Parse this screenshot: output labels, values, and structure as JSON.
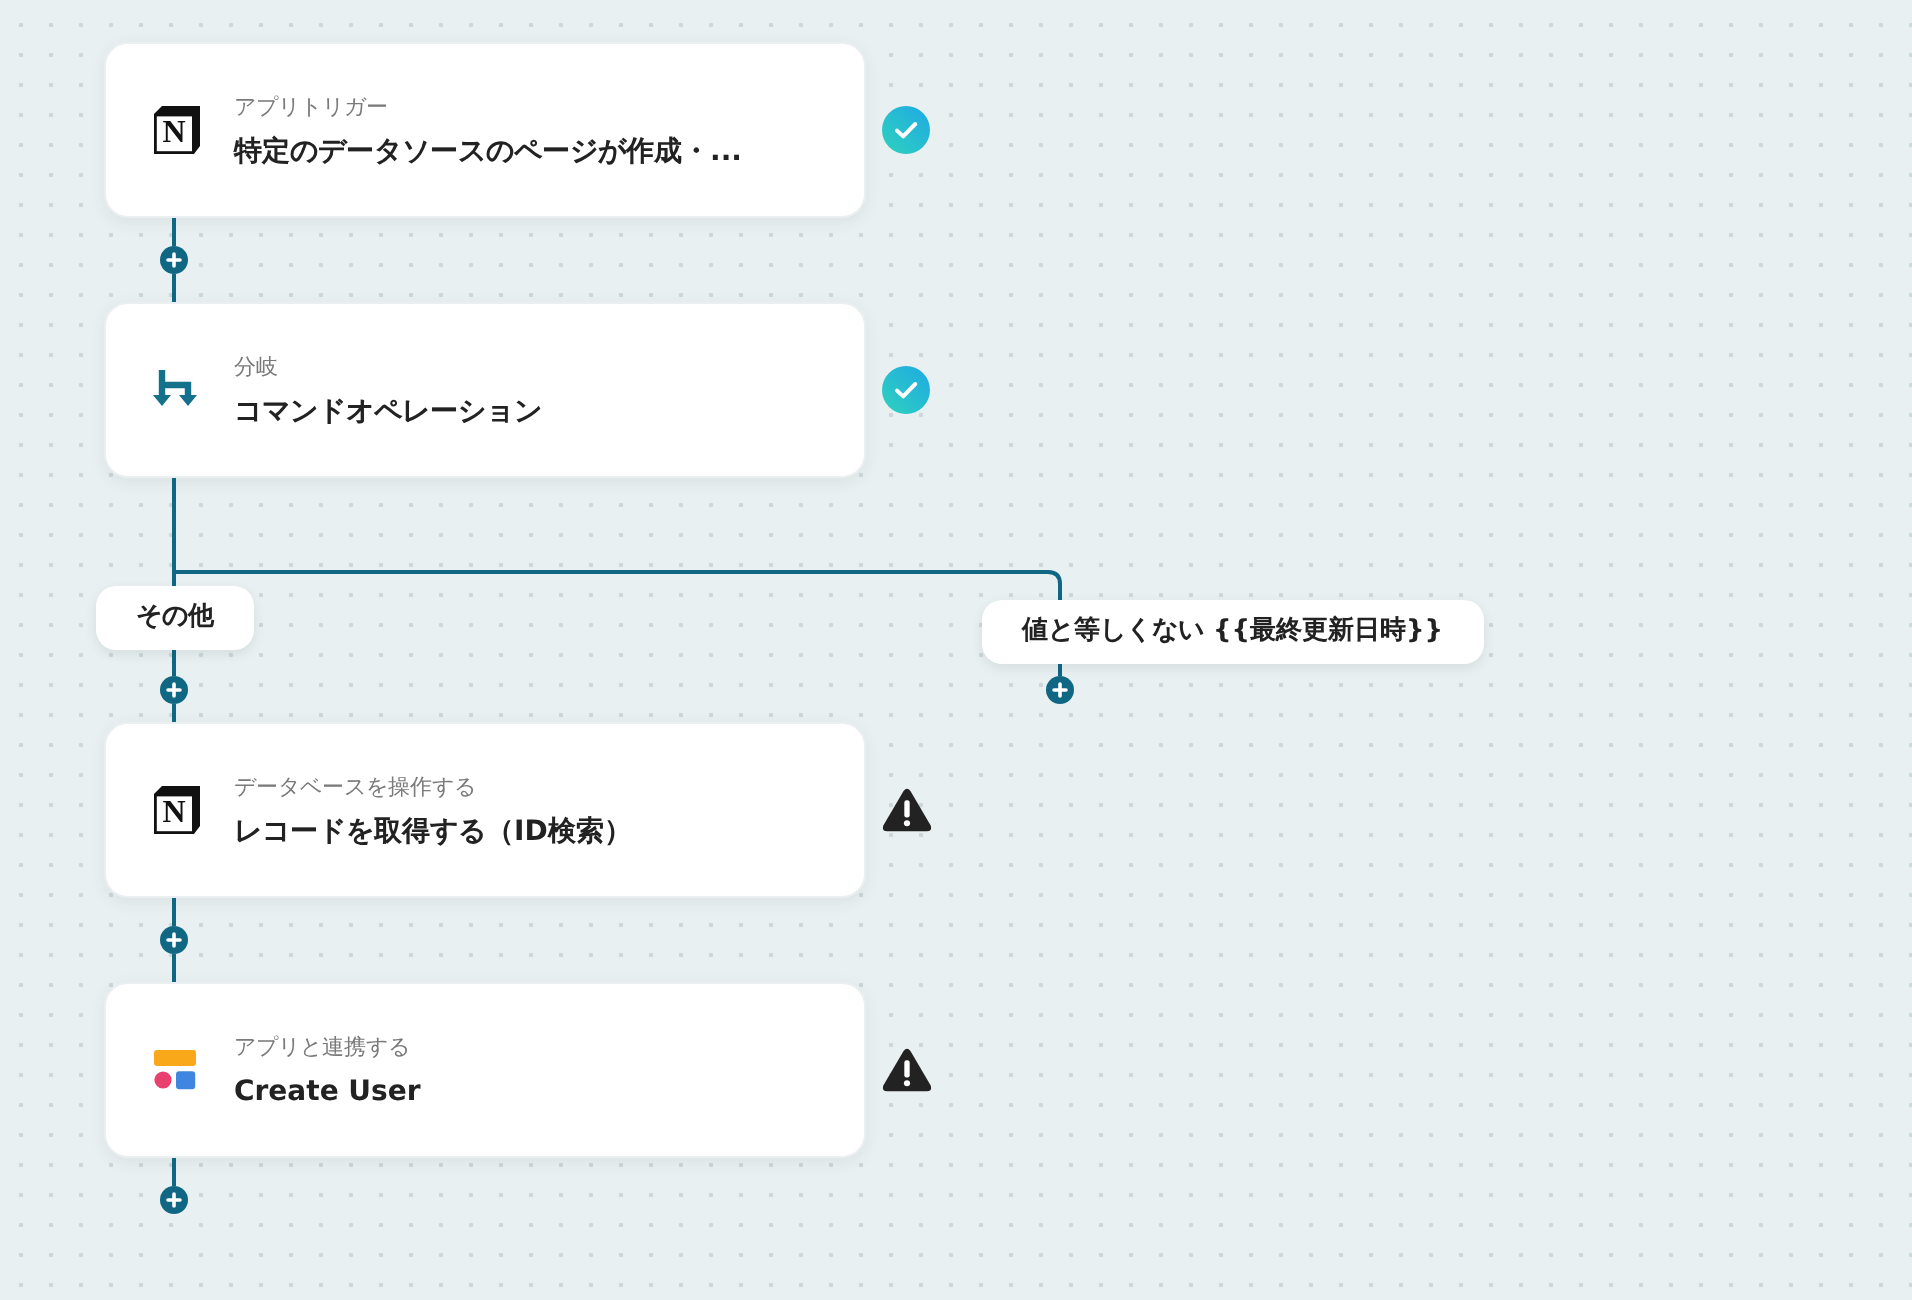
{
  "steps": [
    {
      "kind": "notion",
      "logo": "N",
      "label": "アプリトリガー",
      "title": "特定のデータソースのページが作成・...",
      "done": true
    },
    {
      "kind": "branch",
      "label": "分岐",
      "title": "コマンドオペレーション",
      "done": true
    }
  ],
  "branches": [
    {
      "label": "その他",
      "steps": [
        {
          "kind": "notion",
          "logo": "N",
          "label": "データベースを操作する",
          "title": "レコードを取得する（ID検索）",
          "done": false
        },
        {
          "kind": "app",
          "label": "アプリと連携する",
          "title": "Create User",
          "done": false
        }
      ]
    },
    {
      "label": "値と等しくない {{最終更新日時}}"
    }
  ]
}
